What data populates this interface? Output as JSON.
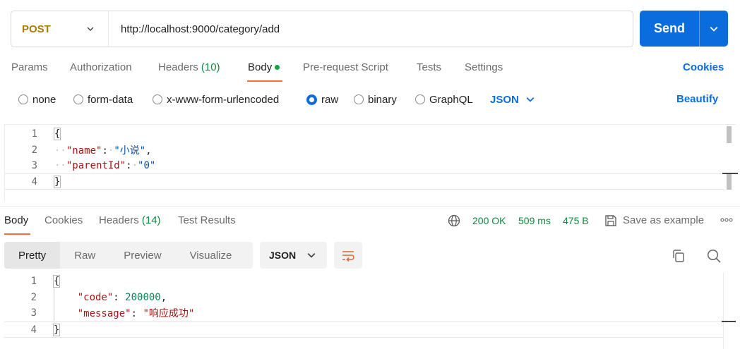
{
  "request": {
    "method": "POST",
    "url": "http://localhost:9000/category/add",
    "send_label": "Send"
  },
  "request_tabs": {
    "params": "Params",
    "authorization": "Authorization",
    "headers_label": "Headers",
    "headers_count": "(10)",
    "body": "Body",
    "pre_request": "Pre-request Script",
    "tests": "Tests",
    "settings": "Settings",
    "cookies": "Cookies"
  },
  "body_types": {
    "none": "none",
    "form_data": "form-data",
    "urlencoded": "x-www-form-urlencoded",
    "raw": "raw",
    "binary": "binary",
    "graphql": "GraphQL",
    "format": "JSON",
    "beautify": "Beautify",
    "selected": "raw"
  },
  "request_body": {
    "line_numbers": [
      "1",
      "2",
      "3",
      "4"
    ],
    "open_brace": "{",
    "close_brace": "}",
    "key1": "\"name\"",
    "val1": "\"小说\"",
    "key2": "\"parentId\"",
    "val2": "\"0\""
  },
  "response_tabs": {
    "body": "Body",
    "cookies": "Cookies",
    "headers_label": "Headers",
    "headers_count": "(14)",
    "test_results": "Test Results"
  },
  "response_status": {
    "status": "200 OK",
    "time": "509 ms",
    "size": "475 B",
    "save_example": "Save as example"
  },
  "response_views": {
    "pretty": "Pretty",
    "raw": "Raw",
    "preview": "Preview",
    "visualize": "Visualize",
    "format": "JSON"
  },
  "response_body": {
    "line_numbers": [
      "1",
      "2",
      "3",
      "4"
    ],
    "open_brace": "{",
    "close_brace": "}",
    "key1": "\"code\"",
    "val1": "200000",
    "key2": "\"message\"",
    "val2": "\"响应成功\""
  },
  "colors": {
    "accent": "#0b6ddd",
    "method": "#ad7a03",
    "status_ok": "#0a8a3c",
    "active_tab": "#ff6c37"
  },
  "icons": [
    "chevron-down-icon",
    "globe-icon",
    "save-icon",
    "more-icon",
    "wrap-lines-icon",
    "copy-icon",
    "search-icon"
  ]
}
